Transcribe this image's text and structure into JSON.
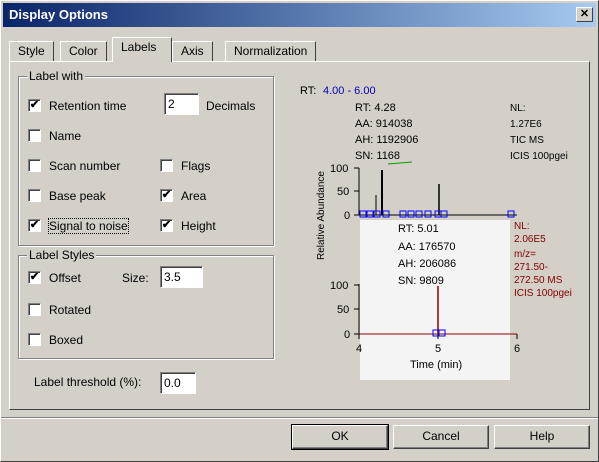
{
  "window": {
    "title": "Display Options",
    "close_glyph": "✕"
  },
  "tabs": [
    "Style",
    "Color",
    "Labels",
    "Axis",
    "Normalization"
  ],
  "active_tab": "Labels",
  "label_with": {
    "title": "Label with",
    "retention_time": {
      "label": "Retention time",
      "checked": true
    },
    "decimals_value": "2",
    "decimals_label": "Decimals",
    "name": {
      "label": "Name",
      "checked": false
    },
    "scan_number": {
      "label": "Scan number",
      "checked": false
    },
    "flags": {
      "label": "Flags",
      "checked": false
    },
    "base_peak": {
      "label": "Base peak",
      "checked": false
    },
    "area": {
      "label": "Area",
      "checked": true
    },
    "signal_to_noise": {
      "label": "Signal to noise",
      "checked": true
    },
    "height": {
      "label": "Height",
      "checked": true
    }
  },
  "label_styles": {
    "title": "Label Styles",
    "offset": {
      "label": "Offset",
      "checked": true
    },
    "size_label": "Size:",
    "size_value": "3.5",
    "rotated": {
      "label": "Rotated",
      "checked": false
    },
    "boxed": {
      "label": "Boxed",
      "checked": false
    }
  },
  "threshold": {
    "label": "Label threshold (%):",
    "value": "0.0"
  },
  "buttons": {
    "ok": "OK",
    "cancel": "Cancel",
    "help": "Help"
  },
  "preview": {
    "rt_prefix": "RT:",
    "rt_range": "4.00 - 6.00",
    "ylabel": "Relative Abundance",
    "xlabel": "Time (min)",
    "top": {
      "peak_labels": [
        "RT: 4.28",
        "AA: 914038",
        "AH: 1192906",
        "SN: 1168"
      ],
      "nl": [
        "NL:",
        "1.27E6",
        "TIC MS",
        "ICIS 100pgei"
      ],
      "yticks": [
        "100",
        "50",
        "0"
      ]
    },
    "bottom": {
      "peak_labels": [
        "RT: 5.01",
        "AA: 176570",
        "AH: 206086",
        "SN: 9809"
      ],
      "nl": [
        "NL:",
        "2.06E5",
        "m/z=",
        "271.50-",
        "272.50 MS",
        "ICIS 100pgei"
      ],
      "yticks": [
        "100",
        "50",
        "0"
      ]
    },
    "xticks": [
      "4",
      "5",
      "6"
    ],
    "colors": {
      "top_text": "#000000",
      "bottom_text": "#800000",
      "rt_range": "#0000c0",
      "marker": "#0000ff",
      "peak_top": "#000000",
      "peak_bottom": "#8b0000",
      "baseline_green": "#00a000"
    }
  }
}
